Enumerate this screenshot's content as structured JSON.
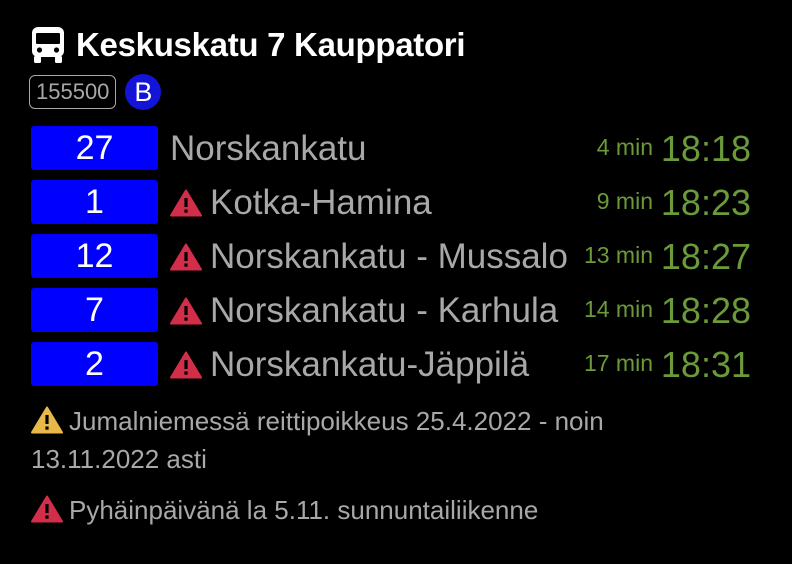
{
  "stop": {
    "name": "Keskuskatu 7 Kauppatori",
    "code": "155500",
    "zone": "B",
    "icon": "bus-icon"
  },
  "departures": [
    {
      "route": "27",
      "destination": "Norskankatu",
      "alert": false,
      "minutes": "4 min",
      "time": "18:18"
    },
    {
      "route": "1",
      "destination": "Kotka-Hamina",
      "alert": true,
      "minutes": "9 min",
      "time": "18:23"
    },
    {
      "route": "12",
      "destination": "Norskankatu - Mussalo",
      "alert": true,
      "minutes": "13 min",
      "time": "18:27"
    },
    {
      "route": "7",
      "destination": "Norskankatu - Karhula",
      "alert": true,
      "minutes": "14 min",
      "time": "18:28"
    },
    {
      "route": "2",
      "destination": "Norskankatu-Jäppilä",
      "alert": true,
      "minutes": "17 min",
      "time": "18:31"
    }
  ],
  "notices": [
    {
      "severity": "warning",
      "icon": "warning-triangle-yellow-icon",
      "text": "Jumalniemessä reittipoikkeus 25.4.2022 - noin 13.11.2022 asti"
    },
    {
      "severity": "alert",
      "icon": "warning-triangle-red-icon",
      "text": "Pyhäinpäivänä la 5.11. sunnuntailiikenne"
    }
  ],
  "colors": {
    "background": "#000000",
    "route_badge": "#0000ff",
    "zone_badge": "#1414d8",
    "time": "#6b9a3a",
    "alert_red": "#d22e4a",
    "warning_yellow": "#e8b84a",
    "text_grey": "#a8a8a8"
  }
}
